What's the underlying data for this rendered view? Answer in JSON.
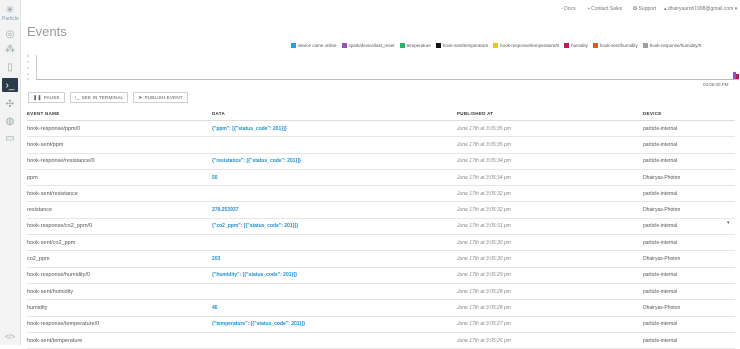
{
  "sidebar": {
    "logo_label": "Particle",
    "items": [
      {
        "icon": "target-icon"
      },
      {
        "icon": "cubes-icon"
      },
      {
        "icon": "document-icon"
      },
      {
        "icon": "terminal-icon",
        "active": true
      },
      {
        "icon": "network-icon"
      },
      {
        "icon": "fingerprint-icon"
      },
      {
        "icon": "card-icon"
      }
    ],
    "bottom_icon": "code-icon"
  },
  "topbar": {
    "docs": "Docs",
    "contact_sales": "Contact Sales",
    "support": "Support",
    "user": "dhairyaaroh1998@gmail.com"
  },
  "page": {
    "title": "Events"
  },
  "legend": [
    {
      "label": "device came online",
      "color": "#1ea5e0"
    },
    {
      "label": "spark/device/last_reset",
      "color": "#9b4fbf"
    },
    {
      "label": "temperature",
      "color": "#27b36b"
    },
    {
      "label": "hook-sent/temperature",
      "color": "#111111"
    },
    {
      "label": "hook-response/temperature/0",
      "color": "#f0c419"
    },
    {
      "label": "humidity",
      "color": "#c2185b"
    },
    {
      "label": "hook-sent/humidity",
      "color": "#e8541a"
    },
    {
      "label": "hook-response/humidity/0",
      "color": "#9e9e9e"
    }
  ],
  "chart": {
    "x_label": "03:06:00 PM",
    "y_ticks": [
      "8",
      "6",
      "4",
      "2",
      "0"
    ]
  },
  "buttons": {
    "pause": "PAUSE",
    "see_terminal": "SEE IN TERMINAL",
    "publish": "PUBLISH EVENT"
  },
  "table": {
    "headers": [
      "EVENT NAME",
      "DATA",
      "PUBLISHED AT",
      "DEVICE"
    ],
    "rows": [
      [
        "hook-response/ppm/0",
        "{\"ppm\": [{\"status_code\": 201}]}",
        "June 17th at 3:05:35 pm",
        "particle-internal"
      ],
      [
        "hook-sent/ppm",
        "",
        "June 17th at 3:05:35 pm",
        "particle-internal"
      ],
      [
        "hook-response/resistance/0",
        "{\"resistance\": [{\"status_code\": 201}]}",
        "June 17th at 3:05:34 pm",
        "particle-internal"
      ],
      [
        "ppm",
        "50",
        "June 17th at 3:05:34 pm",
        "Dhairyas-Photon"
      ],
      [
        "hook-sent/resistance",
        "",
        "June 17th at 3:05:32 pm",
        "particle-internal"
      ],
      [
        "resistance",
        "278.253937",
        "June 17th at 3:05:32 pm",
        "Dhairyas-Photon"
      ],
      [
        "hook-response/co2_ppm/0",
        "{\"co2_ppm\": [{\"status_code\": 201}]}",
        "June 17th at 3:05:31 pm",
        "particle-internal"
      ],
      [
        "hook-sent/co2_ppm",
        "",
        "June 17th at 3:05:30 pm",
        "particle-internal"
      ],
      [
        "co2_ppm",
        "203",
        "June 17th at 3:05:30 pm",
        "Dhairyas-Photon"
      ],
      [
        "hook-response/humidity/0",
        "{\"humidity\": [{\"status_code\": 201}]}",
        "June 17th at 3:05:29 pm",
        "particle-internal"
      ],
      [
        "hook-sent/humidity",
        "",
        "June 17th at 3:05:28 pm",
        "particle-internal"
      ],
      [
        "humidity",
        "46",
        "June 17th at 3:05:28 pm",
        "Dhairyas-Photon"
      ],
      [
        "hook-response/temperature/0",
        "{\"temperature\": [{\"status_code\": 201}]}",
        "June 17th at 3:05:27 pm",
        "particle-internal"
      ],
      [
        "hook-sent/temperature",
        "",
        "June 17th at 3:05:26 pm",
        "particle-internal"
      ]
    ]
  }
}
